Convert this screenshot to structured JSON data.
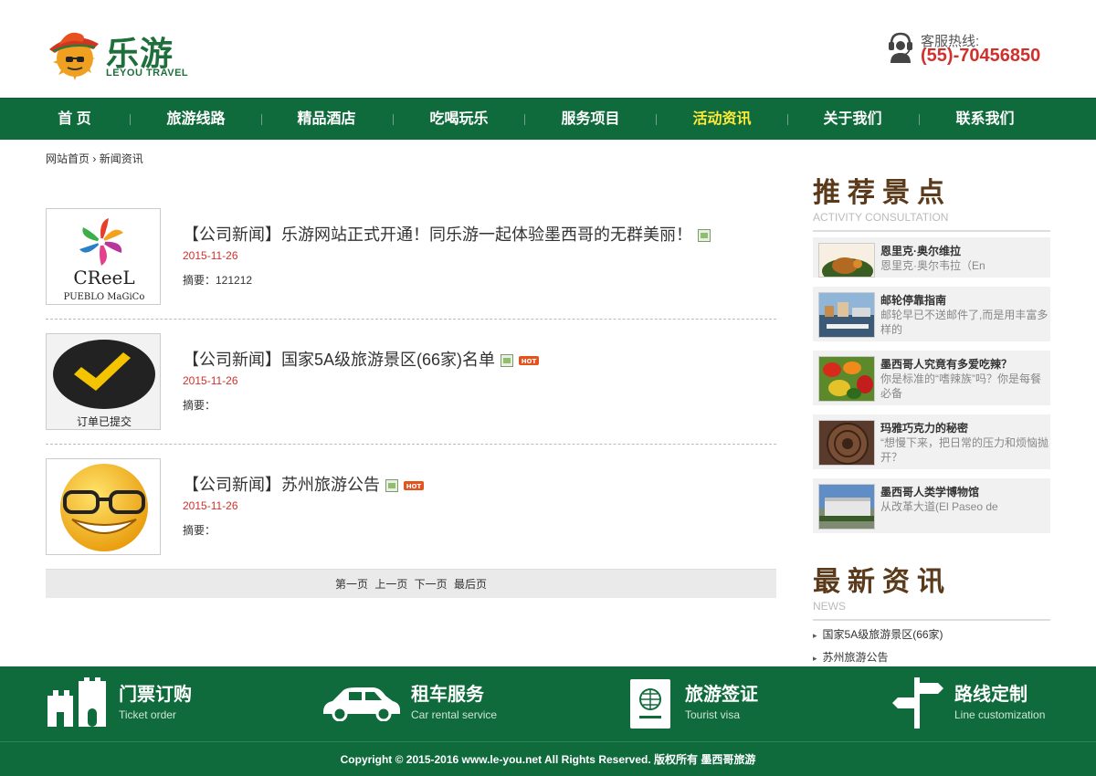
{
  "header": {
    "logo_cn": "乐游",
    "logo_en": "LEYOU TRAVEL",
    "hotline_label": "客服热线:",
    "hotline_number": "(55)-70456850"
  },
  "nav": {
    "items": [
      {
        "label": "首 页"
      },
      {
        "label": "旅游线路"
      },
      {
        "label": "精品酒店"
      },
      {
        "label": "吃喝玩乐"
      },
      {
        "label": "服务项目"
      },
      {
        "label": "活动资讯",
        "active": true
      },
      {
        "label": "关于我们"
      },
      {
        "label": "联系我们"
      }
    ],
    "active_color": "#ffea3a"
  },
  "breadcrumb": {
    "home": "网站首页",
    "separator": "›",
    "current": "新闻资讯"
  },
  "news": [
    {
      "title": "【公司新闻】乐游网站正式开通！同乐游一起体验墨西哥的无群美丽！",
      "date": "2015-11-26",
      "summary": "摘要：121212",
      "thumb_text_1": "CReeL",
      "thumb_text_2": "PUEBLO MaGiCo",
      "hot": false
    },
    {
      "title": "【公司新闻】国家5A级旅游景区(66家)名单",
      "date": "2015-11-26",
      "summary": "摘要：",
      "thumb_text_1": "订单已提交",
      "hot": true
    },
    {
      "title": "【公司新闻】苏州旅游公告",
      "date": "2015-11-26",
      "summary": "摘要：",
      "hot": true
    }
  ],
  "hot_badge": "HOT",
  "pager": {
    "first": "第一页",
    "prev": "上一页",
    "next": "下一页",
    "last": "最后页"
  },
  "sidebar": {
    "recommend_title": "推荐景点",
    "recommend_sub": "ACTIVITY CONSULTATION",
    "spots": [
      {
        "name": "恩里克·奥尔维拉",
        "desc": "恩里克·奥尔韦拉（En"
      },
      {
        "name": "邮轮停靠指南",
        "desc": "邮轮早已不送邮件了,而是用丰富多样的"
      },
      {
        "name": "墨西哥人究竟有多爱吃辣？",
        "desc": "你是标准的“嗜辣族”吗？你是每餐必备"
      },
      {
        "name": "玛雅巧克力的秘密",
        "desc": "“想慢下来，把日常的压力和烦恼抛开？"
      },
      {
        "name": "墨西哥人类学博物馆",
        "desc": "从改革大道(El Paseo de"
      }
    ],
    "latest_title": "最新资讯",
    "latest_sub": "NEWS",
    "latest": [
      {
        "label": "国家5A级旅游景区(66家)"
      },
      {
        "label": "苏州旅游公告"
      }
    ]
  },
  "services": [
    {
      "title": "门票订购",
      "en": "Ticket order",
      "icon": "castle-icon"
    },
    {
      "title": "租车服务",
      "en": "Car rental service",
      "icon": "car-icon"
    },
    {
      "title": "旅游签证",
      "en": "Tourist visa",
      "icon": "passport-icon"
    },
    {
      "title": "路线定制",
      "en": "Line customization",
      "icon": "signpost-icon"
    }
  ],
  "footer": {
    "copyright": "Copyright © 2015-2016 www.le-you.net All Rights Reserved. 版权所有 墨西哥旅游"
  },
  "colors": {
    "brand_green": "#106b3c",
    "date_red": "#d0312d",
    "title_brown": "#5a3a1a"
  }
}
